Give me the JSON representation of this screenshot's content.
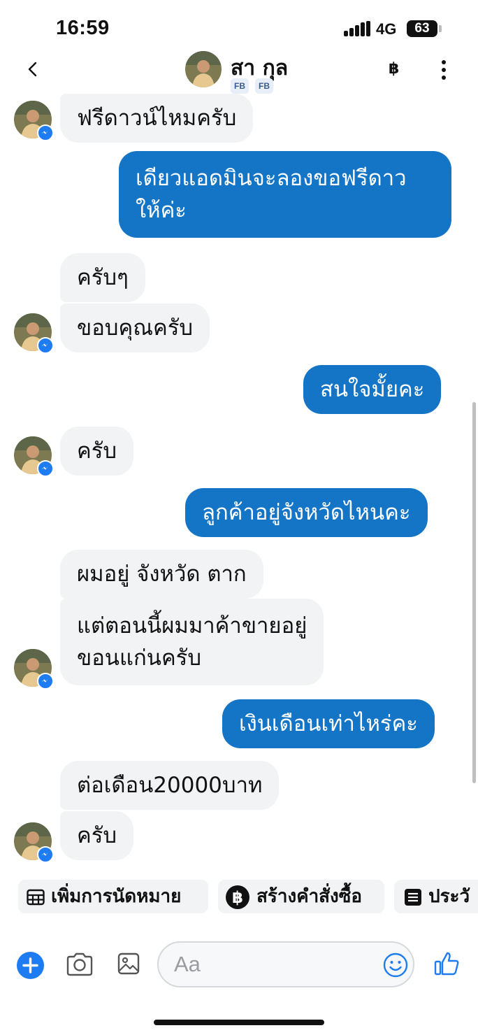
{
  "status_bar": {
    "time": "16:59",
    "network": "4G",
    "battery": "63"
  },
  "header": {
    "contact_name": "สา กุล",
    "badges": [
      "FB",
      "FB"
    ],
    "currency_icon": "฿",
    "icons": [
      "back-chevron-icon",
      "baht-icon",
      "more-vertical-icon"
    ]
  },
  "messages": [
    {
      "side": "in",
      "text": "ฟรีดาวน์ไหมครับ"
    },
    {
      "side": "out",
      "text_lines": [
        "เดียวแอดมินจะลองขอฟรีดาว",
        "ให้ค่ะ"
      ]
    },
    {
      "side": "in",
      "text": "ครับๆ"
    },
    {
      "side": "in",
      "text": "ขอบคุณครับ"
    },
    {
      "side": "out",
      "text": "สนใจมั้ยคะ"
    },
    {
      "side": "in",
      "text": "ครับ"
    },
    {
      "side": "out",
      "text": "ลูกค้าอยู่จังหวัดไหนคะ"
    },
    {
      "side": "in",
      "text": "ผมอยู่ จังหวัด ตาก"
    },
    {
      "side": "in",
      "text_lines": [
        "แต่ตอนนี้ผมมาค้าขายอยู่",
        "ขอนแก่นครับ"
      ]
    },
    {
      "side": "out",
      "text": "เงินเดือนเท่าไหร่คะ"
    },
    {
      "side": "in",
      "text": "ต่อเดือน20000บาท"
    },
    {
      "side": "in",
      "text": "ครับ"
    }
  ],
  "quick_actions": [
    {
      "label": "เพิ่มการนัดหมาย",
      "icon": "calendar-grid-icon"
    },
    {
      "label": "สร้างคำสั่งซื้อ",
      "icon": "baht-coin-icon"
    },
    {
      "label": "ประวั",
      "icon": "list-icon"
    }
  ],
  "composer": {
    "placeholder": "Aa",
    "icons": [
      "add-icon",
      "camera-icon",
      "gallery-icon",
      "emoji-icon",
      "thumbs-up-icon"
    ]
  },
  "colors": {
    "outgoing_bubble": "#1475c6",
    "incoming_bubble": "#f2f3f5",
    "accent": "#1d7cf2"
  }
}
